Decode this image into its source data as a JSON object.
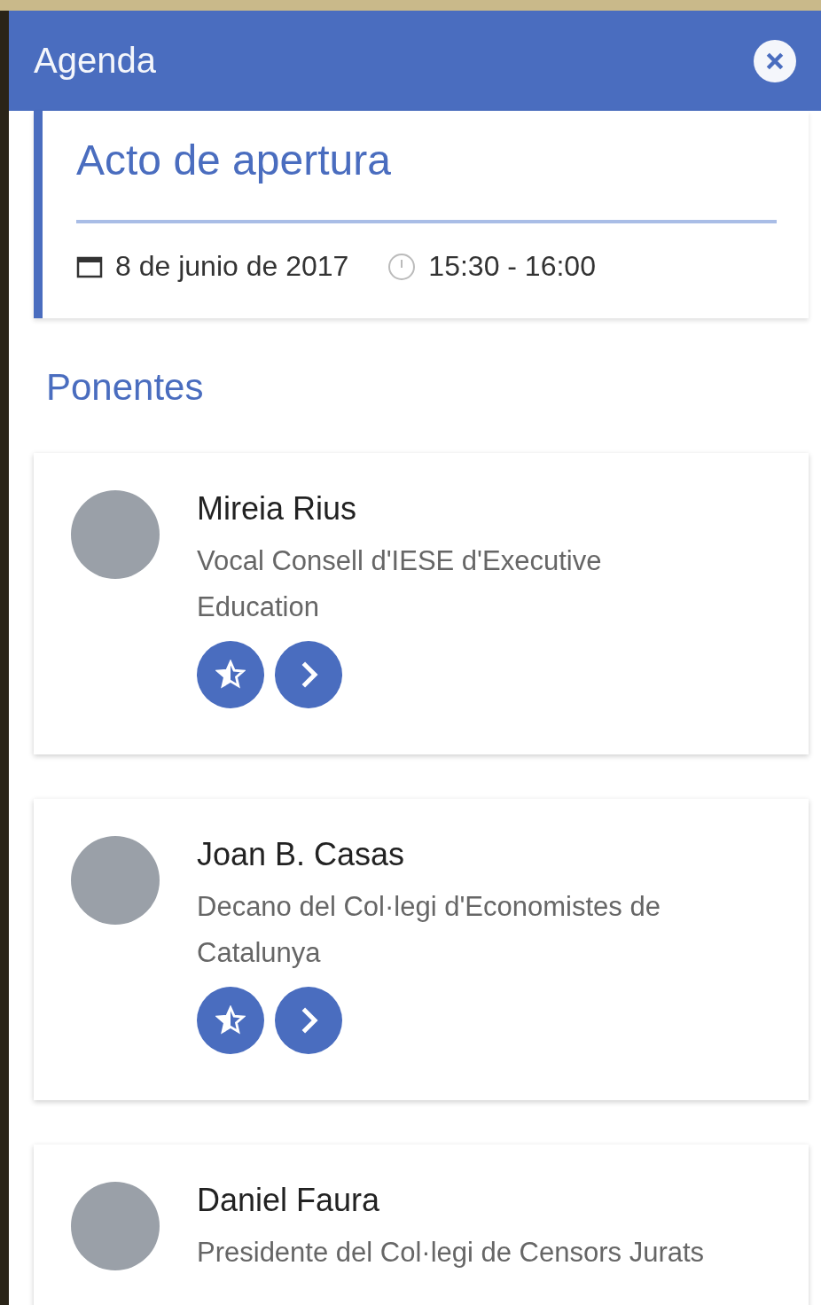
{
  "header": {
    "title": "Agenda"
  },
  "event": {
    "title": "Acto de apertura",
    "date": "8 de junio de 2017",
    "time": "15:30 - 16:00"
  },
  "section_title": "Ponentes",
  "speakers": [
    {
      "name": "Mireia Rius",
      "role": "Vocal Consell d'IESE d'Executive Education",
      "actions": [
        {
          "kind": "favorite"
        },
        {
          "kind": "details"
        }
      ]
    },
    {
      "name": "Joan B. Casas",
      "role": "Decano del Col·legi d'Economistes de Catalunya",
      "actions": [
        {
          "kind": "favorite"
        },
        {
          "kind": "details"
        }
      ]
    },
    {
      "name": "Daniel Faura",
      "role": "Presidente del Col·legi de Censors Jurats"
    }
  ]
}
